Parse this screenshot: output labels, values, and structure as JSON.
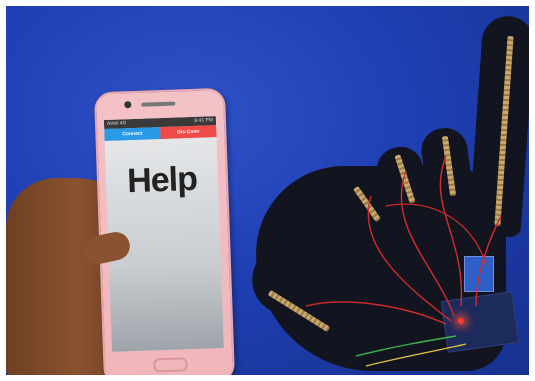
{
  "phone_app": {
    "status_left": "Airtel 4G",
    "status_right": "9:41 PM",
    "connect_label": "Connect",
    "disconnect_label": "Dis-Conn",
    "message": "Help"
  },
  "colors": {
    "background": "#1f3fb4",
    "connect": "#2a9ae6",
    "disconnect": "#ef4a45",
    "phone_body": "#f0b5ba",
    "glove": "#121520",
    "wire": "#d42b2b"
  }
}
